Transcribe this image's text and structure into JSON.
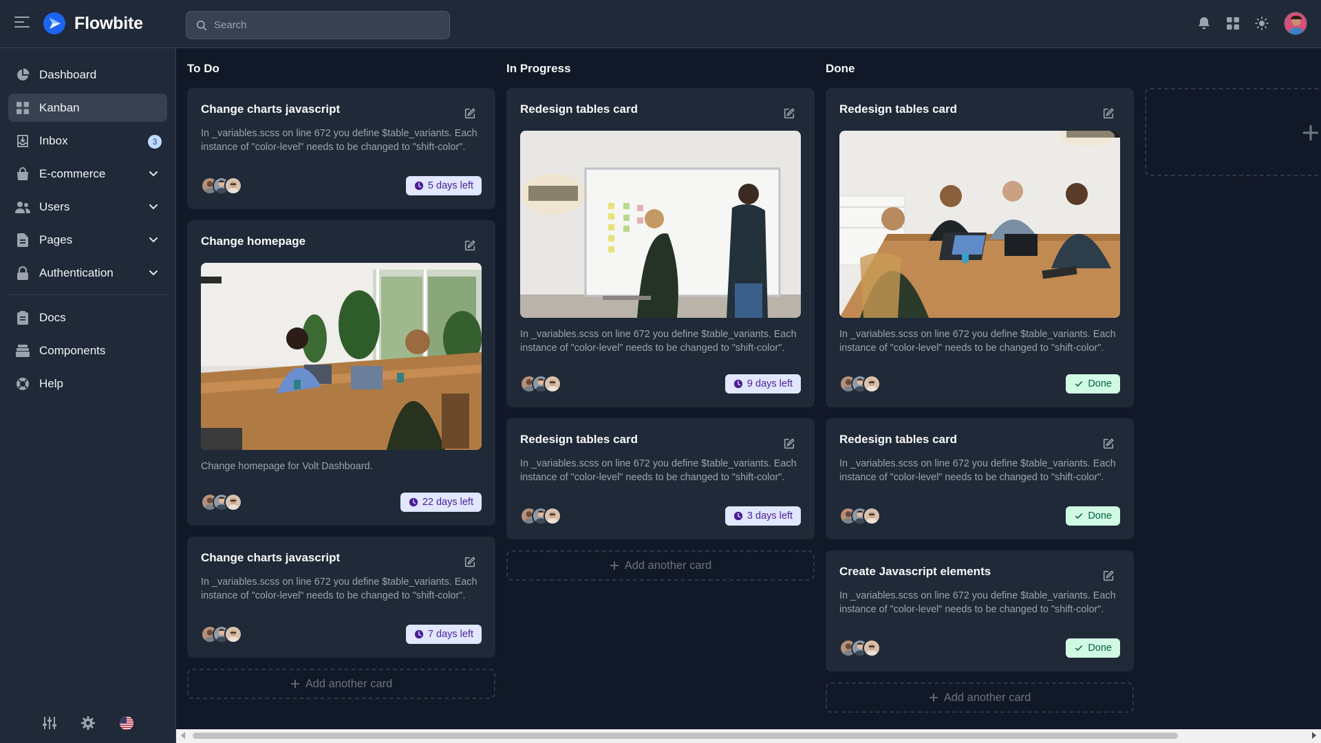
{
  "app": {
    "name": "Flowbite"
  },
  "search": {
    "placeholder": "Search"
  },
  "sidebar": {
    "items": [
      {
        "label": "Dashboard",
        "icon": "pie-chart-icon"
      },
      {
        "label": "Kanban",
        "icon": "grid-icon",
        "active": true
      },
      {
        "label": "Inbox",
        "icon": "inbox-icon",
        "badge": "3"
      },
      {
        "label": "E-commerce",
        "icon": "shopping-bag-icon",
        "expandable": true
      },
      {
        "label": "Users",
        "icon": "users-icon",
        "expandable": true
      },
      {
        "label": "Pages",
        "icon": "document-icon",
        "expandable": true
      },
      {
        "label": "Authentication",
        "icon": "lock-icon",
        "expandable": true
      }
    ],
    "secondary": [
      {
        "label": "Docs",
        "icon": "clipboard-icon"
      },
      {
        "label": "Components",
        "icon": "stack-icon"
      },
      {
        "label": "Help",
        "icon": "lifebuoy-icon"
      }
    ],
    "bottom": [
      "sliders-icon",
      "gear-icon",
      "us-flag-icon"
    ]
  },
  "board": {
    "columns": [
      {
        "title": "To Do",
        "add_label": "Add another card",
        "cards": [
          {
            "title": "Change charts javascript",
            "desc": "In _variables.scss on line 672 you define $table_variants. Each instance of \"color-level\" needs to be changed to \"shift-color\".",
            "status": "5 days left",
            "type": "days"
          },
          {
            "title": "Change homepage",
            "desc": "Change homepage for Volt Dashboard.",
            "status": "22 days left",
            "type": "days",
            "image": "office-meeting-two-women"
          },
          {
            "title": "Change charts javascript",
            "desc": "In _variables.scss on line 672 you define $table_variants. Each instance of \"color-level\" needs to be changed to \"shift-color\".",
            "status": "7 days left",
            "type": "days"
          }
        ]
      },
      {
        "title": "In Progress",
        "add_label": "Add another card",
        "cards": [
          {
            "title": "Redesign tables card",
            "desc": "In _variables.scss on line 672 you define $table_variants. Each instance of \"color-level\" needs to be changed to \"shift-color\".",
            "status": "9 days left",
            "type": "days",
            "image": "whiteboard-meeting"
          },
          {
            "title": "Redesign tables card",
            "desc": "In _variables.scss on line 672 you define $table_variants. Each instance of \"color-level\" needs to be changed to \"shift-color\".",
            "status": "3 days left",
            "type": "days"
          }
        ]
      },
      {
        "title": "Done",
        "add_label": "Add another card",
        "cards": [
          {
            "title": "Redesign tables card",
            "desc": "In _variables.scss on line 672 you define $table_variants. Each instance of \"color-level\" needs to be changed to \"shift-color\".",
            "status": "Done",
            "type": "done",
            "image": "team-table-meeting"
          },
          {
            "title": "Redesign tables card",
            "desc": "In _variables.scss on line 672 you define $table_variants. Each instance of \"color-level\" needs to be changed to \"shift-color\".",
            "status": "Done",
            "type": "done"
          },
          {
            "title": "Create Javascript elements",
            "desc": "In _variables.scss on line 672 you define $table_variants. Each instance of \"color-level\" needs to be changed to \"shift-color\".",
            "status": "Done",
            "type": "done"
          }
        ]
      }
    ]
  },
  "colors": {
    "background": "#111827",
    "surface": "#1f2937",
    "brand": "#1c64f2",
    "days_badge_bg": "#e0e7ff",
    "done_badge_bg": "#d1fae5"
  }
}
